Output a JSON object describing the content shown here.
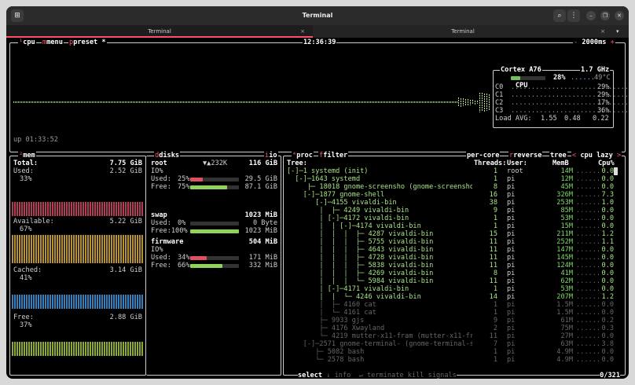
{
  "window": {
    "title": "Terminal",
    "tabs": [
      {
        "label": "Terminal",
        "active": true
      },
      {
        "label": "Terminal",
        "active": false
      }
    ],
    "tab_close": "×"
  },
  "header": {
    "cpu": "cpu",
    "menu": "menu",
    "preset": "preset *",
    "clock": "12:36:39",
    "interval": "2000ms",
    "uptime": "up 01:33:52",
    "minus": "-",
    "plus": "+"
  },
  "cpu_panel": {
    "name": "Cortex A76",
    "freq": "1.7 GHz",
    "total_label": "CPU",
    "total_pct": "28%",
    "total_level": 0.28,
    "temp": "49°C",
    "cores": [
      {
        "label": "C0",
        "pct": "29%"
      },
      {
        "label": "C1",
        "pct": "29%"
      },
      {
        "label": "C2",
        "pct": "17%"
      },
      {
        "label": "C3",
        "pct": "36%"
      }
    ],
    "load_label": "Load AVG:",
    "load": [
      "1.55",
      "0.48",
      "0.22"
    ]
  },
  "mem": {
    "title": "mem",
    "total_label": "Total:",
    "total": "7.75 GiB",
    "used_label": "Used:",
    "used": "2.52 GiB",
    "used_pct": "33%",
    "avail_label": "Available:",
    "avail": "5.22 GiB",
    "avail_pct": "67%",
    "cached_label": "Cached:",
    "cached": "3.14 GiB",
    "cached_pct": "41%",
    "free_label": "Free:",
    "free": "2.88 GiB",
    "free_pct": "37%"
  },
  "disks": {
    "title": "disks",
    "io_tab": "io",
    "items": [
      {
        "name": "root",
        "io_rate": "▼▲232K",
        "size": "116 GiB",
        "io": "IO%",
        "used_label": "Used:",
        "used_pct": "25%",
        "used_level": 0.25,
        "used": "29.5 GiB",
        "free_label": "Free:",
        "free_pct": "75%",
        "free_level": 0.75,
        "free": "87.1 GiB"
      },
      {
        "name": "swap",
        "io_rate": "",
        "size": "1023 MiB",
        "io": "",
        "used_label": "Used:",
        "used_pct": "0%",
        "used_level": 0,
        "used": "0 Byte",
        "free_label": "Free:100%",
        "free_pct": "",
        "free_level": 1,
        "free": "1023 MiB"
      },
      {
        "name": "firmware",
        "io_rate": "",
        "size": "504 MiB",
        "io": "IO%",
        "used_label": "Used:",
        "used_pct": "34%",
        "used_level": 0.34,
        "used": "171 MiB",
        "free_label": "Free:",
        "free_pct": "66%",
        "free_level": 0.66,
        "free": "332 MiB"
      }
    ]
  },
  "proc": {
    "title": "proc",
    "filter": "filter",
    "per_core": "per-core",
    "reverse": "reverse",
    "tree": "tree",
    "sort": "cpu lazy",
    "headers": {
      "tree": "Tree:",
      "threads": "Threads:",
      "user": "User:",
      "mem": "MemB",
      "cpu": "Cpu%"
    },
    "rows": [
      {
        "tree": "[-]─1 systemd (init)",
        "th": "1",
        "user": "root",
        "mem": "14M",
        "cpu": "0.0",
        "dim": false
      },
      {
        "tree": "  [-]─1643 systemd",
        "th": "1",
        "user": "pi",
        "mem": "12M",
        "cpu": "0.0",
        "dim": false
      },
      {
        "tree": "     ├─ 18018 gnome-screensho (gnome-screenshot)",
        "th": "8",
        "user": "pi",
        "mem": "45M",
        "cpu": "0.0",
        "dim": false
      },
      {
        "tree": "    [-]─1877 gnome-shell",
        "th": "16",
        "user": "pi",
        "mem": "326M",
        "cpu": "7.3",
        "dim": false
      },
      {
        "tree": "       [-]─4155 vivaldi-bin",
        "th": "38",
        "user": "pi",
        "mem": "253M",
        "cpu": "1.0",
        "dim": false
      },
      {
        "tree": "        │  ├─ 4249 vivaldi-bin",
        "th": "9",
        "user": "pi",
        "mem": "85M",
        "cpu": "0.0",
        "dim": false
      },
      {
        "tree": "        │ [-]─4172 vivaldi-bin",
        "th": "1",
        "user": "pi",
        "mem": "53M",
        "cpu": "0.0",
        "dim": false
      },
      {
        "tree": "        │  │ [-]─4174 vivaldi-bin",
        "th": "1",
        "user": "pi",
        "mem": "15M",
        "cpu": "0.0",
        "dim": false
      },
      {
        "tree": "        │  │  │  ├─ 4287 vivaldi-bin",
        "th": "15",
        "user": "pi",
        "mem": "211M",
        "cpu": "1.2",
        "dim": false
      },
      {
        "tree": "        │  │  │  ├─ 5755 vivaldi-bin",
        "th": "11",
        "user": "pi",
        "mem": "252M",
        "cpu": "1.1",
        "dim": false
      },
      {
        "tree": "        │  │  │  ├─ 4643 vivaldi-bin",
        "th": "11",
        "user": "pi",
        "mem": "147M",
        "cpu": "0.0",
        "dim": false
      },
      {
        "tree": "        │  │  │  ├─ 4728 vivaldi-bin",
        "th": "11",
        "user": "pi",
        "mem": "145M",
        "cpu": "0.0",
        "dim": false
      },
      {
        "tree": "        │  │  │  ├─ 5838 vivaldi-bin",
        "th": "11",
        "user": "pi",
        "mem": "124M",
        "cpu": "0.0",
        "dim": false
      },
      {
        "tree": "        │  │  │  ├─ 4269 vivaldi-bin",
        "th": "8",
        "user": "pi",
        "mem": "41M",
        "cpu": "0.0",
        "dim": false
      },
      {
        "tree": "        │  │  │  └─ 5984 vivaldi-bin",
        "th": "11",
        "user": "pi",
        "mem": "62M",
        "cpu": "0.0",
        "dim": false
      },
      {
        "tree": "        │ [-]─4171 vivaldi-bin",
        "th": "1",
        "user": "pi",
        "mem": "53M",
        "cpu": "0.0",
        "dim": false
      },
      {
        "tree": "        │  │  └─ 4246 vivaldi-bin",
        "th": "14",
        "user": "pi",
        "mem": "207M",
        "cpu": "1.2",
        "dim": false
      },
      {
        "tree": "        │  ├─ 4160 cat",
        "th": "1",
        "user": "pi",
        "mem": "1.5M",
        "cpu": "0.0",
        "dim": true
      },
      {
        "tree": "        │  └─ 4161 cat",
        "th": "1",
        "user": "pi",
        "mem": "1.5M",
        "cpu": "0.0",
        "dim": true
      },
      {
        "tree": "        ├─ 9933 gjs",
        "th": "9",
        "user": "pi",
        "mem": "61M",
        "cpu": "0.2",
        "dim": true
      },
      {
        "tree": "        ├─ 4176 Xwayland",
        "th": "2",
        "user": "pi",
        "mem": "75M",
        "cpu": "0.3",
        "dim": true
      },
      {
        "tree": "        └─ 4219 mutter-x11-fram (mutter-x11-fram)",
        "th": "11",
        "user": "pi",
        "mem": "27M",
        "cpu": "0.0",
        "dim": true
      },
      {
        "tree": "    [-]─2571 gnome-terminal- (gnome-terminal-ser)",
        "th": "7",
        "user": "pi",
        "mem": "63M",
        "cpu": "3.8",
        "dim": true
      },
      {
        "tree": "       ├─ 5082 bash",
        "th": "1",
        "user": "pi",
        "mem": "4.9M",
        "cpu": "0.0",
        "dim": true
      },
      {
        "tree": "       └─ 2578 bash",
        "th": "1",
        "user": "pi",
        "mem": "4.9M",
        "cpu": "0.0",
        "dim": true
      }
    ],
    "footer": {
      "select": "select",
      "info": "info",
      "terminate": "terminate",
      "kill": "kill",
      "signals": "signals",
      "count": "0/321"
    }
  }
}
